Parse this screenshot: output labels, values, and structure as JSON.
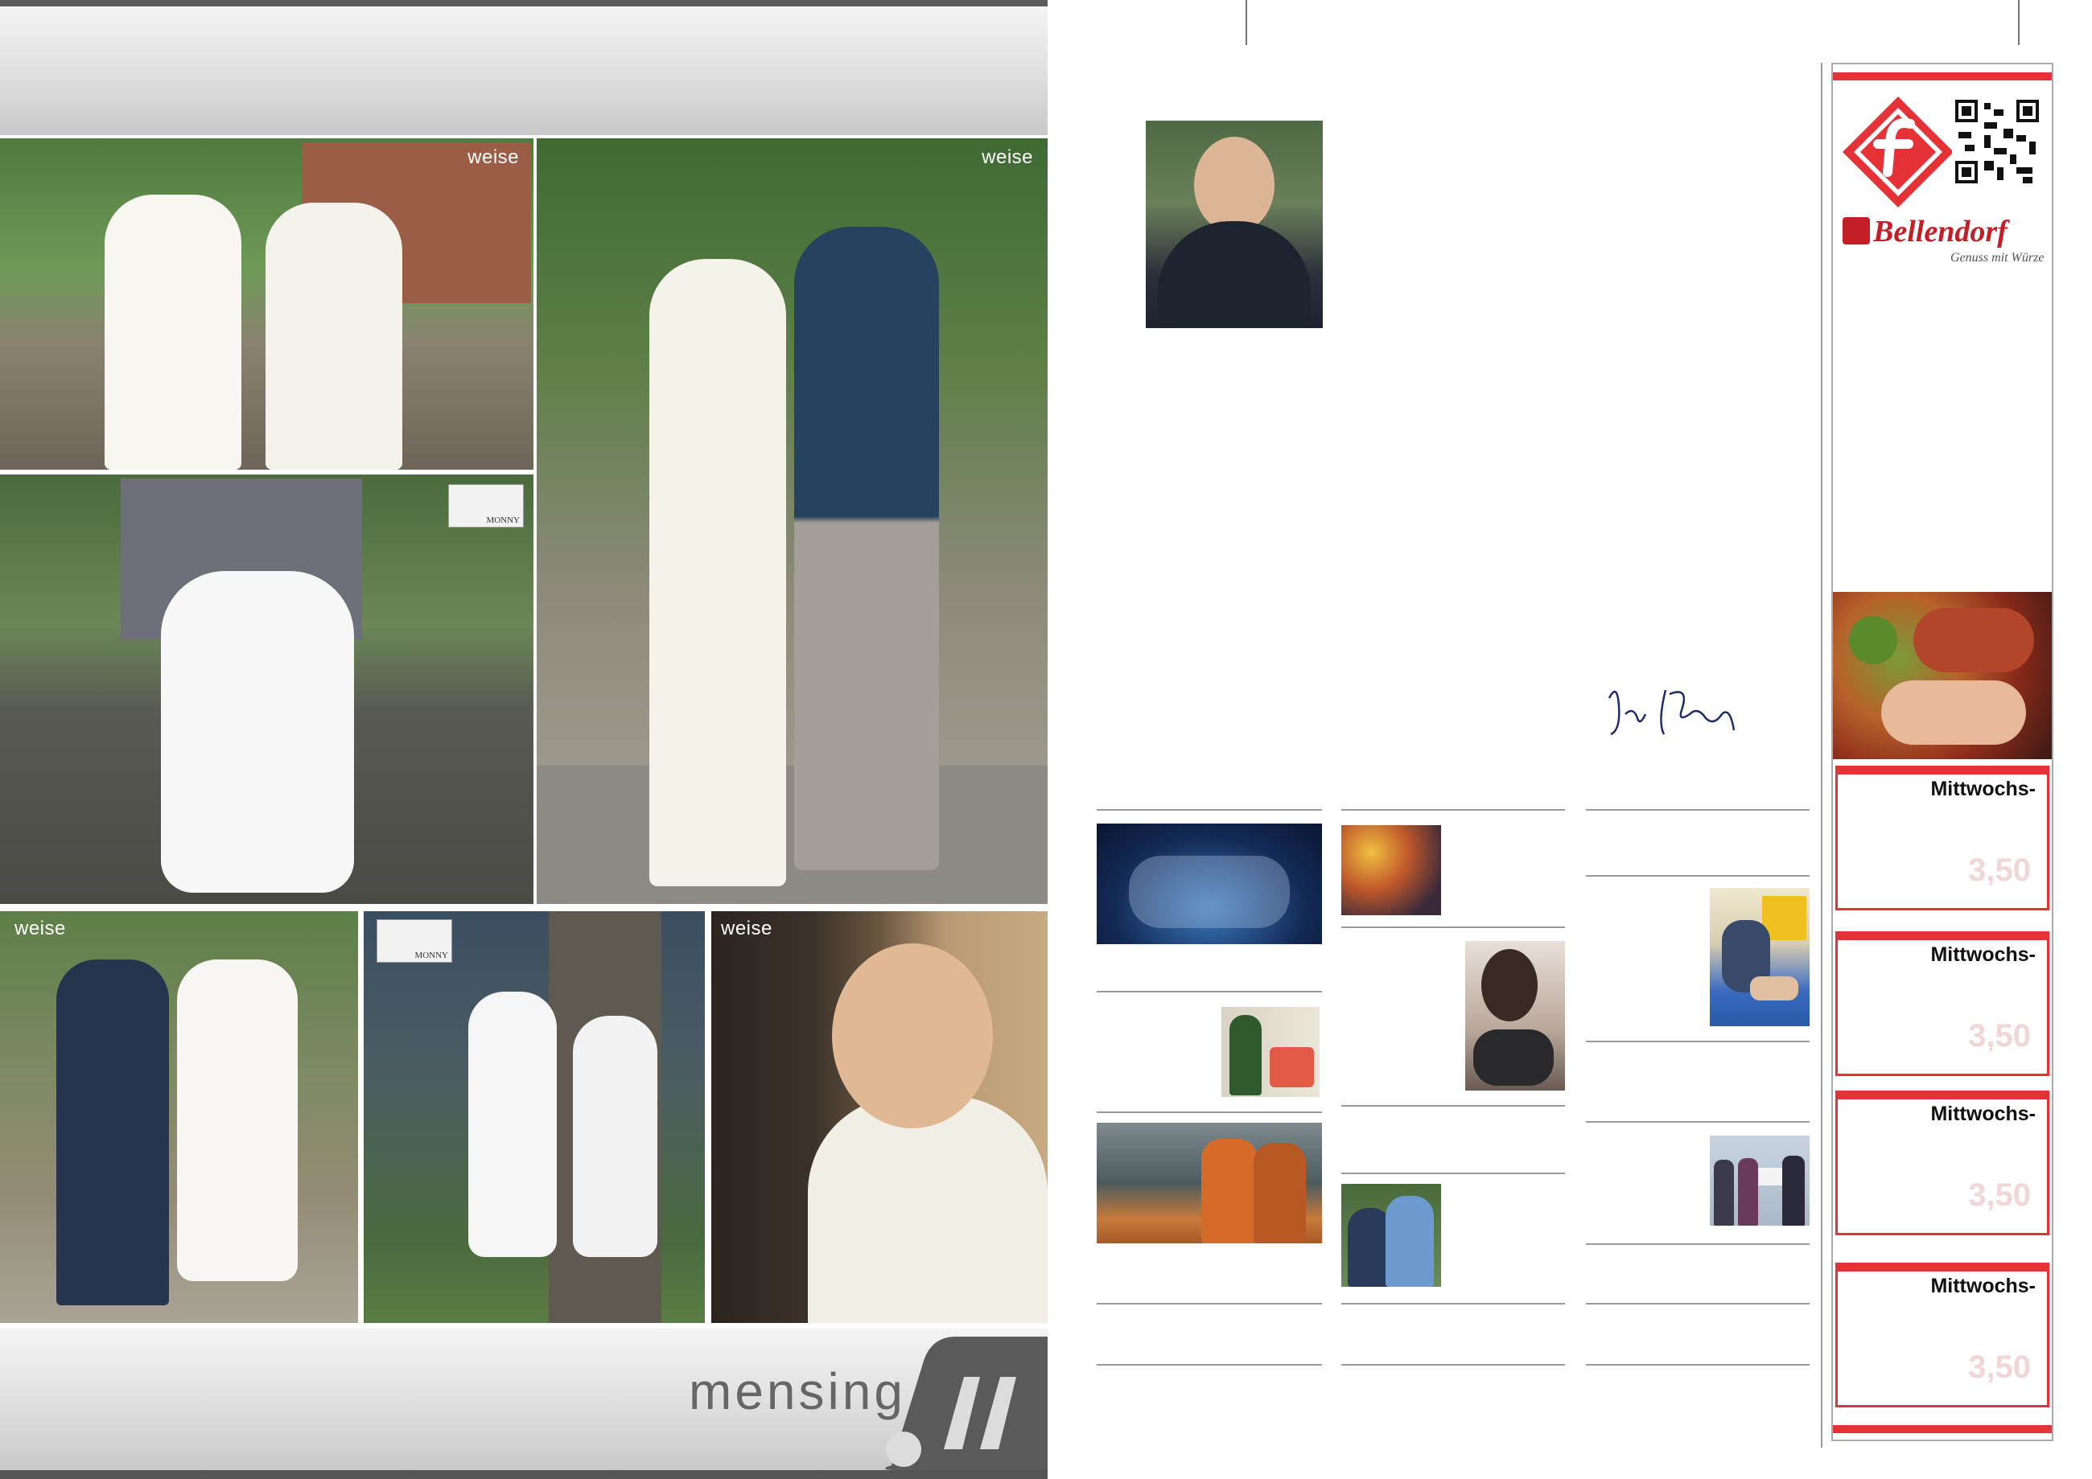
{
  "left_page": {
    "photo_brands": {
      "weise": "weise",
      "monny": "MONNY"
    },
    "footer_brand": "mensing"
  },
  "right_page": {
    "sidebar": {
      "bellendorf_logo": "Bellendorf",
      "bellendorf_tagline": "Genuss mit Würze",
      "offers": [
        {
          "label": "Mittwochs-",
          "price": "3,50"
        },
        {
          "label": "Mittwochs-",
          "price": "3,50"
        },
        {
          "label": "Mittwochs-",
          "price": "3,50"
        },
        {
          "label": "Mittwochs-",
          "price": "3,50"
        }
      ]
    }
  },
  "colors": {
    "accent_red": "#e53237",
    "rule_gray": "#9a9a9a"
  }
}
